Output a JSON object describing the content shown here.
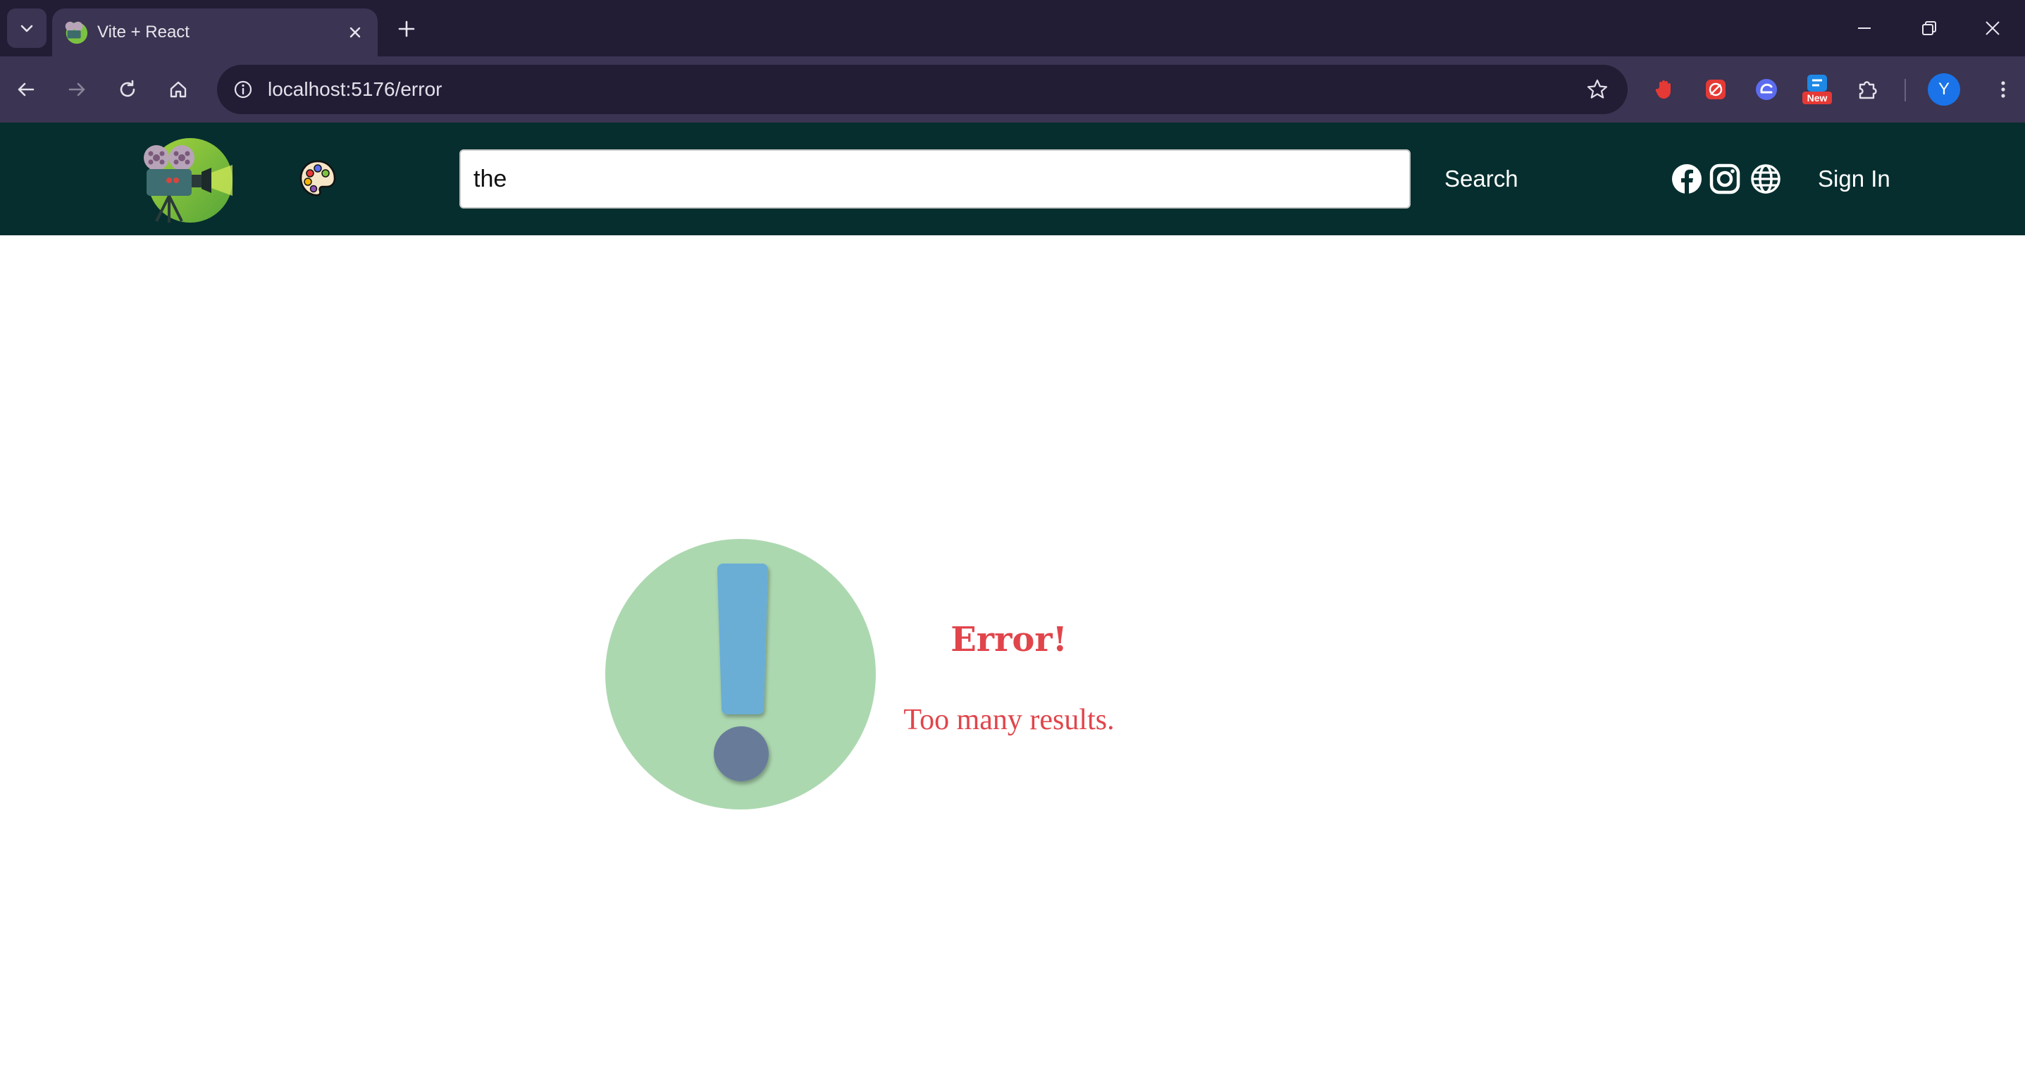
{
  "browser": {
    "tab": {
      "title": "Vite + React",
      "favicon": "movie-camera-favicon"
    },
    "url": "localhost:5176/error",
    "profile_initial": "Y",
    "extensions": [
      {
        "name": "ublock-extension-icon",
        "color": "#e53935"
      },
      {
        "name": "red-extension-icon",
        "color": "#e53935"
      },
      {
        "name": "blue-extension-icon",
        "color": "#5b6cf0"
      },
      {
        "name": "new-extension-icon",
        "badge": "New",
        "color": "#1e88e5"
      },
      {
        "name": "puzzle-extensions-icon"
      }
    ]
  },
  "header": {
    "logo": "movie-camera-logo",
    "theme_icon": "palette-icon",
    "search": {
      "value": "the",
      "button_label": "Search"
    },
    "social_icons": [
      "facebook-icon",
      "instagram-icon",
      "globe-icon"
    ],
    "sign_in_label": "Sign In"
  },
  "error": {
    "title": "Error!",
    "message": "Too many results.",
    "icon": "exclamation-icon"
  },
  "colors": {
    "tabstrip": "#221c35",
    "toolbar": "#3b3452",
    "header_bg": "#062e2e",
    "error_text": "#e0454b",
    "illustration_circle": "#acd8b0",
    "exclamation_bar": "#6aaed6",
    "exclamation_dot": "#677b99"
  }
}
